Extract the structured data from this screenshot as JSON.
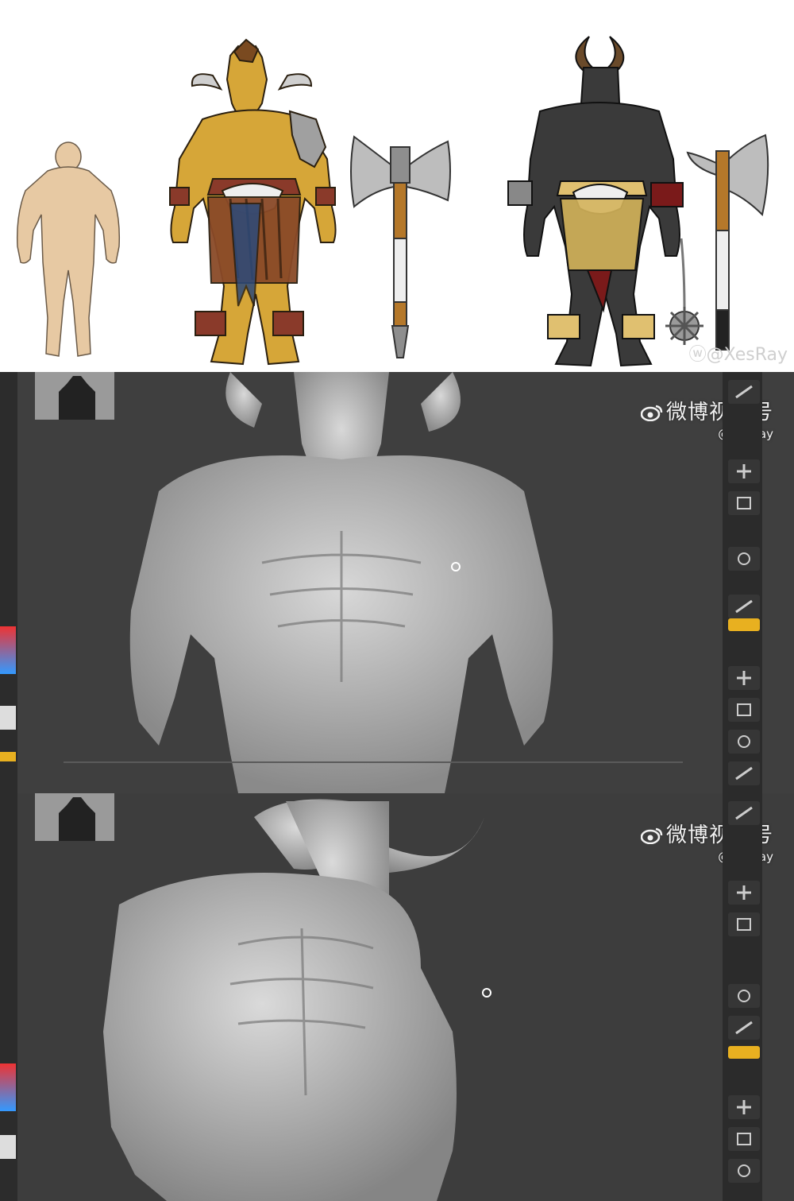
{
  "concept": {
    "credit": "@XesRay"
  },
  "shot1": {
    "watermark_line1": "微博视频号",
    "watermark_line2": "@XesRay"
  },
  "shot2": {
    "watermark_line1": "微博视频号",
    "watermark_line2": "@XesRay"
  },
  "icons": [
    "weibo-logo-icon",
    "tool-brush-icon",
    "tool-move-icon",
    "tool-scale-icon",
    "tool-rotate-icon",
    "rotation-handle-icon"
  ],
  "colors": {
    "skin_tan": "#e7c9a3",
    "gold_body": "#d6a638",
    "dark_body": "#3a3a3a",
    "sculpt_gray": "#b9b9b9",
    "ui_panel": "#2b2b2b",
    "ui_accent": "#e8b020"
  }
}
